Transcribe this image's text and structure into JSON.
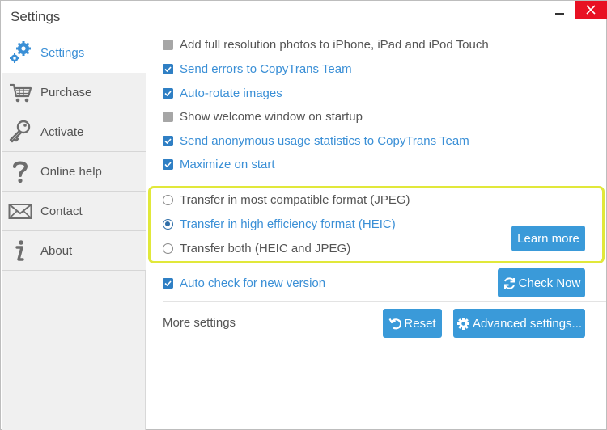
{
  "window": {
    "title": "Settings"
  },
  "sidebar": {
    "items": [
      {
        "label": "Settings",
        "icon": "gear-icon",
        "active": true
      },
      {
        "label": "Purchase",
        "icon": "cart-icon",
        "active": false
      },
      {
        "label": "Activate",
        "icon": "key-icon",
        "active": false
      },
      {
        "label": "Online help",
        "icon": "question-icon",
        "active": false
      },
      {
        "label": "Contact",
        "icon": "envelope-icon",
        "active": false
      },
      {
        "label": "About",
        "icon": "info-icon",
        "active": false
      }
    ]
  },
  "options": [
    {
      "label": "Add full resolution photos to iPhone, iPad and iPod Touch",
      "checked": false
    },
    {
      "label": "Send errors to CopyTrans Team",
      "checked": true
    },
    {
      "label": "Auto-rotate images",
      "checked": true
    },
    {
      "label": "Show welcome window on startup",
      "checked": false
    },
    {
      "label": "Send anonymous usage statistics to CopyTrans Team",
      "checked": true
    },
    {
      "label": "Maximize on start",
      "checked": true
    }
  ],
  "format": {
    "options": [
      {
        "label": "Transfer in most compatible format (JPEG)",
        "selected": false
      },
      {
        "label": "Transfer in high efficiency format (HEIC)",
        "selected": true
      },
      {
        "label": "Transfer both (HEIC and JPEG)",
        "selected": false
      }
    ],
    "learn_more_label": "Learn more"
  },
  "update": {
    "auto_check_label": "Auto check for new version",
    "auto_check_checked": true,
    "check_now_label": "Check Now"
  },
  "more": {
    "label": "More settings",
    "reset_label": "Reset",
    "advanced_label": "Advanced settings..."
  },
  "colors": {
    "accent": "#3a9ad9",
    "checked_box": "#2f7fc4",
    "highlight_border": "#e1e83a",
    "close_button": "#e81123"
  }
}
